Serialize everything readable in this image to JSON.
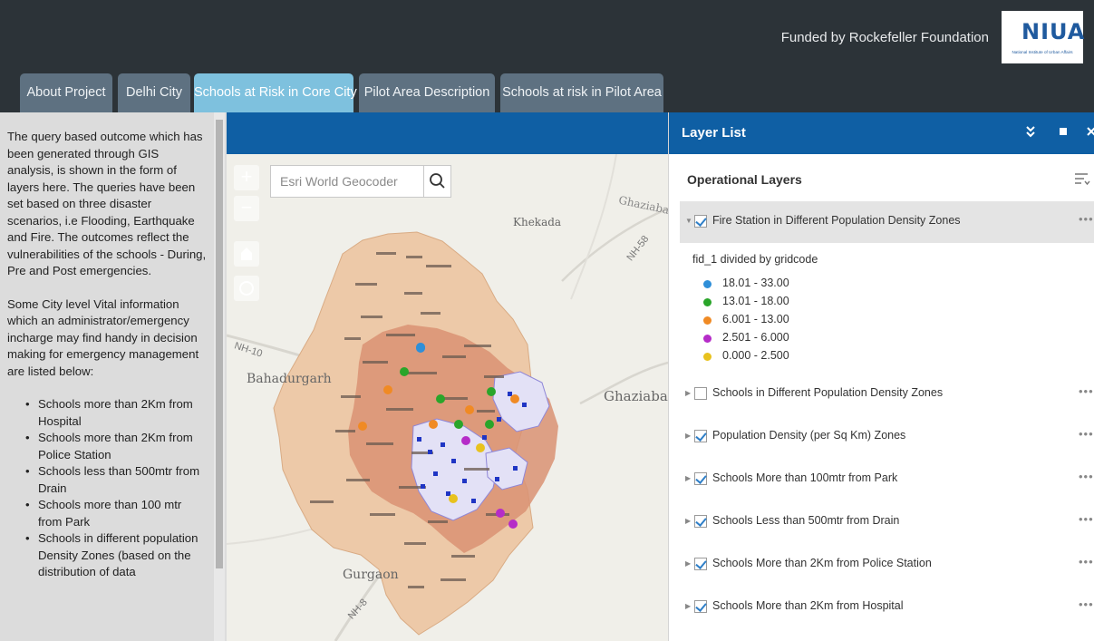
{
  "header": {
    "funded_by": "Funded by Rockefeller Foundation",
    "logo_text": "NIUA",
    "logo_subtext": "National Institute of Urban Affairs"
  },
  "tabs": [
    {
      "label": "About Project",
      "active": false
    },
    {
      "label": "Delhi City",
      "active": false
    },
    {
      "label": "Schools at Risk in Core City",
      "active": true
    },
    {
      "label": "Pilot Area Description",
      "active": false
    },
    {
      "label": "Schools at risk in Pilot Area",
      "active": false
    }
  ],
  "left_panel": {
    "paragraph_1": "The query based outcome which has been generated through GIS analysis, is shown in the form of layers here. The queries have been set based on three disaster scenarios, i.e Flooding, Earthquake and Fire. The outcomes reflect the vulnerabilities of the schools - During, Pre and Post emergencies.",
    "paragraph_2": "Some City level Vital information which an administrator/emergency incharge may find handy in decision making for emergency management are listed below:",
    "bullets": [
      "Schools more than 2Km from Hospital",
      "Schools more than 2Km from Police Station",
      "Schools less than 500mtr from Drain",
      "Schools more than 100 mtr from Park",
      "Schools in different population Density Zones (based on the distribution of data"
    ]
  },
  "map": {
    "zoom_in": "+",
    "zoom_out": "−",
    "search_placeholder": "Esri World Geocoder",
    "labels": {
      "khekada": "Khekada",
      "ghaziabad_top": "Ghaziabad",
      "ghaziabad": "Ghaziabad",
      "bahadurgarh": "Bahadurgarh",
      "gurgaon": "Gurgaon",
      "nh10": "NH-10",
      "nh8": "NH-8",
      "nh58": "NH-58"
    }
  },
  "layer_list": {
    "title": "Layer List",
    "operational_title": "Operational Layers",
    "more": "•••",
    "legend_title": "fid_1 divided by gridcode",
    "legend": [
      {
        "label": "18.01 - 33.00",
        "color": "#2f8fd8"
      },
      {
        "label": "13.01 - 18.00",
        "color": "#2aa52a"
      },
      {
        "label": "6.001 - 13.00",
        "color": "#f08a24"
      },
      {
        "label": "2.501 - 6.000",
        "color": "#b52cc8"
      },
      {
        "label": "0.000 - 2.500",
        "color": "#e8c21e"
      }
    ],
    "layers": [
      {
        "label": "Fire Station in Different Population Density Zones",
        "checked": true,
        "expanded": true
      },
      {
        "label": "Schools in Different Population Density Zones",
        "checked": false
      },
      {
        "label": "Population Density (per Sq Km) Zones",
        "checked": true
      },
      {
        "label": "Schools More than 100mtr from Park",
        "checked": true
      },
      {
        "label": "Schools Less than 500mtr from Drain",
        "checked": true
      },
      {
        "label": "Schools More than 2Km from Police Station",
        "checked": true
      },
      {
        "label": "Schools More than 2Km from Hospital",
        "checked": true
      }
    ]
  },
  "colors": {
    "header_bg": "#2c3338",
    "tab_bg": "#5e7181",
    "tab_active_bg": "#7ec1de",
    "panel_header_bg": "#0f5fa4",
    "delhi_fill": "#edc9a8",
    "density_fill": "#d99273"
  }
}
